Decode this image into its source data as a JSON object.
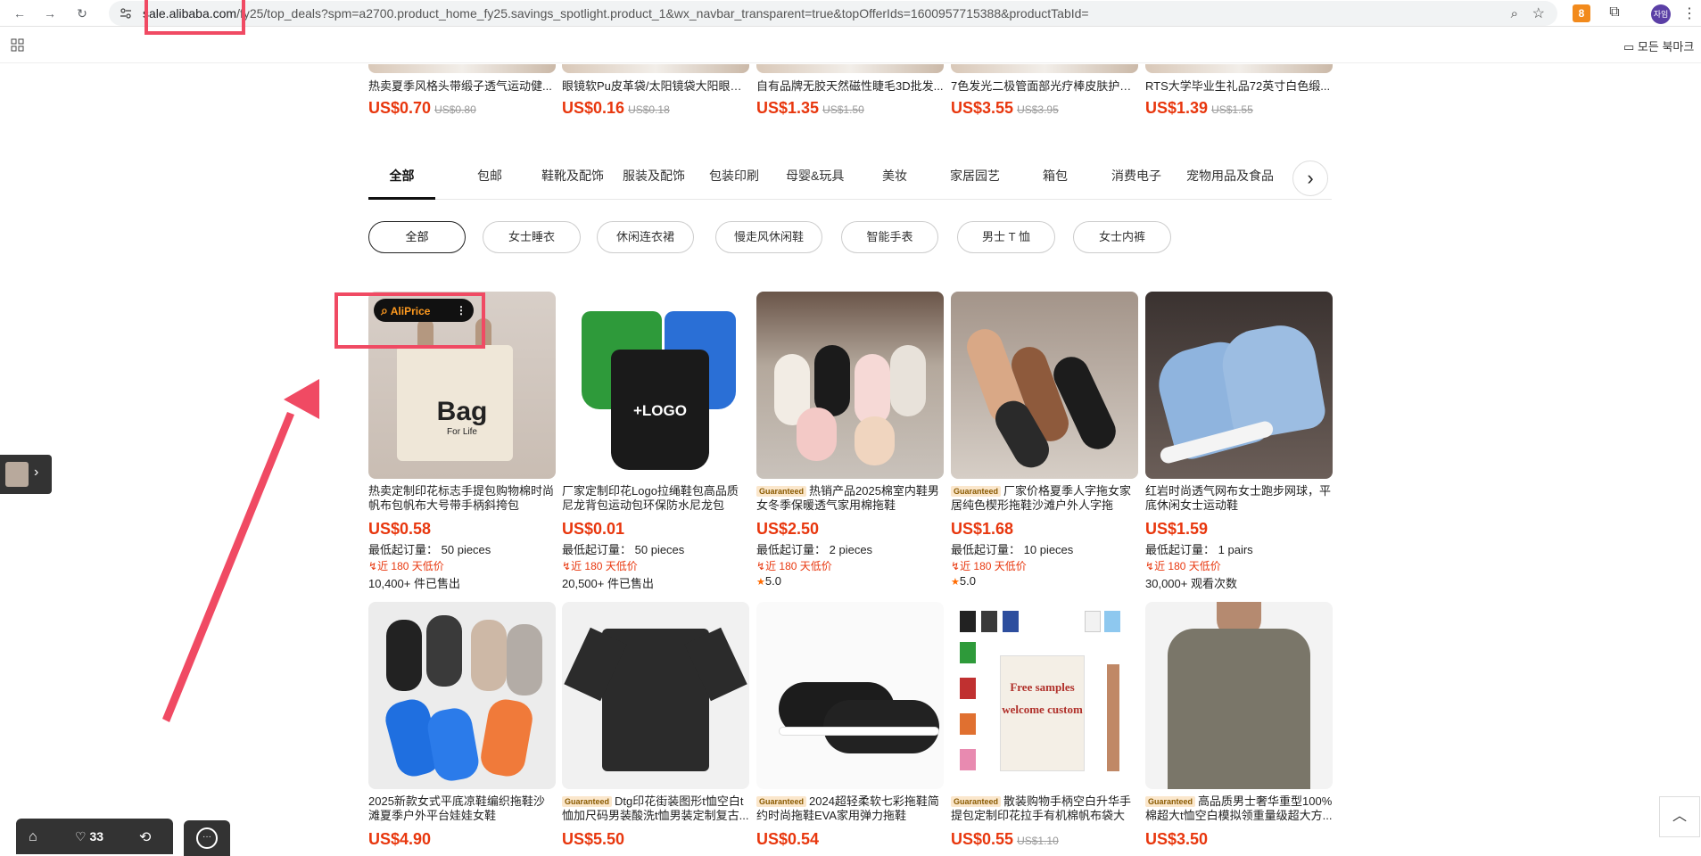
{
  "browser": {
    "url_host": "sale.alibaba.com",
    "url_path": "/fy25/top_deals?spm=a2700.product_home_fy25.savings_spotlight.product_1&wx_navbar_transparent=true&topOfferIds=1600957715388&productTabId=",
    "bookmarks_label": "모든 북마크",
    "profile_label": "자임",
    "ext_badge": "8"
  },
  "top_row": [
    {
      "title": "热卖夏季风格头带缎子透气运动健...",
      "price": "US$0.70",
      "old_price": "US$0.80"
    },
    {
      "title": "眼镜软Pu皮革袋/太阳镜袋大阳眼镜...",
      "price": "US$0.16",
      "old_price": "US$0.18"
    },
    {
      "title": "自有品牌无胶天然磁性睫毛3D批发...",
      "price": "US$1.35",
      "old_price": "US$1.50"
    },
    {
      "title": "7色发光二极管面部光疗棒皮肤护理...",
      "price": "US$3.55",
      "old_price": "US$3.95"
    },
    {
      "title": "RTS大学毕业生礼品72英寸白色缎...",
      "price": "US$1.39",
      "old_price": "US$1.55"
    }
  ],
  "tabs": [
    "全部",
    "包邮",
    "鞋靴及配饰",
    "服装及配饰",
    "包装印刷",
    "母婴&玩具",
    "美妆",
    "家居园艺",
    "箱包",
    "消费电子",
    "宠物用品及食品"
  ],
  "chips": [
    "全部",
    "女士睡衣",
    "休闲连衣裙",
    "慢走风休闲鞋",
    "智能手表",
    "男士 T 恤",
    "女士内裤"
  ],
  "aliprice_label": "AliPrice",
  "products_row1": [
    {
      "title": "热卖定制印花标志手提包购物棉时尚帆布包帆布大号带手柄斜挎包",
      "guaranteed": "",
      "price": "US$0.58",
      "moq_label": "最低起订量：",
      "moq": "50 pieces",
      "low_label": "近 180 天低价",
      "extra": "10,400+ 件已售出",
      "img_text": "Bag",
      "img_sub": "For Life"
    },
    {
      "title": "厂家定制印花Logo拉绳鞋包高品质尼龙背包运动包环保防水尼龙包",
      "guaranteed": "",
      "price": "US$0.01",
      "moq_label": "最低起订量：",
      "moq": "50 pieces",
      "low_label": "近 180 天低价",
      "extra": "20,500+ 件已售出",
      "img_text": "+LOGO",
      "img_sub": ""
    },
    {
      "title": "热销产品2025棉室内鞋男女冬季保暖透气家用棉拖鞋",
      "guaranteed": "Guaranteed",
      "price": "US$2.50",
      "moq_label": "最低起订量：",
      "moq": "2 pieces",
      "low_label": "近 180 天低价",
      "extra": "5.0",
      "img_text": "",
      "img_sub": ""
    },
    {
      "title": "厂家价格夏季人字拖女家居纯色楔形拖鞋沙滩户外人字拖",
      "guaranteed": "Guaranteed",
      "price": "US$1.68",
      "moq_label": "最低起订量：",
      "moq": "10 pieces",
      "low_label": "近 180 天低价",
      "extra": "5.0",
      "img_text": "",
      "img_sub": ""
    },
    {
      "title": "红岩时尚透气网布女士跑步网球，平底休闲女士运动鞋",
      "guaranteed": "",
      "price": "US$1.59",
      "moq_label": "最低起订量：",
      "moq": "1 pairs",
      "low_label": "近 180 天低价",
      "extra": "30,000+ 观看次数",
      "img_text": "",
      "img_sub": ""
    }
  ],
  "products_row2": [
    {
      "title": "2025新款女式平底凉鞋编织拖鞋沙滩夏季户外平台娃娃女鞋",
      "guaranteed": "",
      "price": "US$4.90",
      "old_price": ""
    },
    {
      "title": "Dtg印花街装图形t恤空白t恤加尺码男装酸洗t恤男装定制复古...",
      "guaranteed": "Guaranteed",
      "price": "US$5.50",
      "old_price": ""
    },
    {
      "title": "2024超轻柔软七彩拖鞋简约时尚拖鞋EVA家用弹力拖鞋",
      "guaranteed": "Guaranteed",
      "price": "US$0.54",
      "old_price": ""
    },
    {
      "title": "散装购物手柄空白升华手提包定制印花拉手有机棉帆布袋大沙...",
      "guaranteed": "Guaranteed",
      "price": "US$0.55",
      "old_price": "US$1.10",
      "img_text": "Free samples",
      "img_sub": "welcome custom"
    },
    {
      "title": "高品质男士奢华重型100%棉超大t恤空白模拟领重量级超大方...",
      "guaranteed": "Guaranteed",
      "price": "US$3.50",
      "old_price": ""
    }
  ],
  "bottom_bar": {
    "likes": "33"
  },
  "colors": {
    "price": "#e8370e",
    "highlight": "#f04a63",
    "accent": "#ff6a00"
  }
}
